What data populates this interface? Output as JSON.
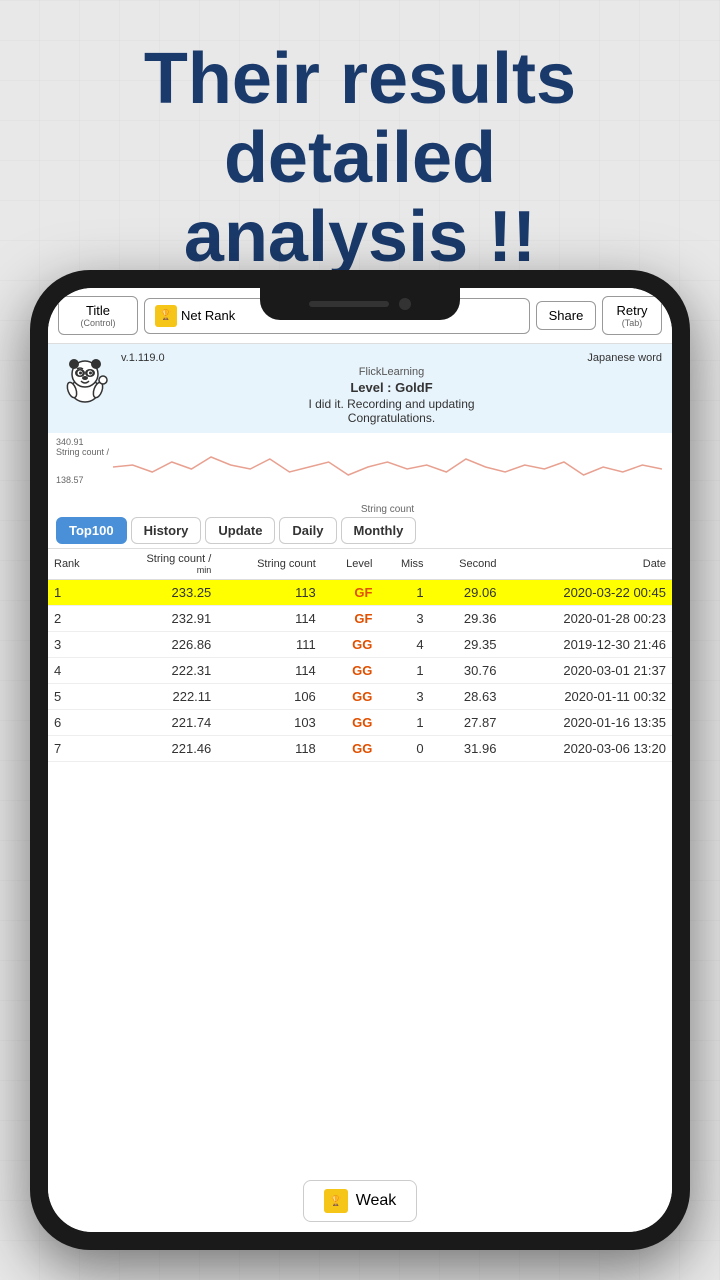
{
  "headline": {
    "line1": "Their results",
    "line2": "detailed",
    "line3": "analysis !!"
  },
  "toolbar": {
    "title_label": "Title",
    "title_sub": "(Control)",
    "net_rank_label": "Net Rank",
    "share_label": "Share",
    "retry_label": "Retry",
    "retry_sub": "(Tab)"
  },
  "info": {
    "version": "v.1.119.0",
    "app_name": "FlickLearning",
    "category": "Japanese word",
    "level": "Level : GoldF",
    "message": "I did it. Recording and updating",
    "congrats": "Congratulations."
  },
  "chart": {
    "y_max": "340.91",
    "y_label": "String count /",
    "y_min": "138.57",
    "x_label": "String count"
  },
  "tabs": [
    {
      "id": "top100",
      "label": "Top100",
      "active": true
    },
    {
      "id": "history",
      "label": "History",
      "active": false
    },
    {
      "id": "update",
      "label": "Update",
      "active": false
    },
    {
      "id": "daily",
      "label": "Daily",
      "active": false
    },
    {
      "id": "monthly",
      "label": "Monthly",
      "active": false
    }
  ],
  "table": {
    "headers": [
      {
        "label": "Rank",
        "sub": ""
      },
      {
        "label": "String count /",
        "sub": "min"
      },
      {
        "label": "String count",
        "sub": ""
      },
      {
        "label": "Level",
        "sub": ""
      },
      {
        "label": "Miss",
        "sub": ""
      },
      {
        "label": "Second",
        "sub": ""
      },
      {
        "label": "Date",
        "sub": ""
      }
    ],
    "rows": [
      {
        "rank": "1",
        "string_per_min": "233.25",
        "string_count": "113",
        "level": "GF",
        "miss": "1",
        "second": "29.06",
        "date": "2020-03-22 00:45",
        "highlight": true
      },
      {
        "rank": "2",
        "string_per_min": "232.91",
        "string_count": "114",
        "level": "GF",
        "miss": "3",
        "second": "29.36",
        "date": "2020-01-28 00:23",
        "highlight": false
      },
      {
        "rank": "3",
        "string_per_min": "226.86",
        "string_count": "111",
        "level": "GG",
        "miss": "4",
        "second": "29.35",
        "date": "2019-12-30 21:46",
        "highlight": false
      },
      {
        "rank": "4",
        "string_per_min": "222.31",
        "string_count": "114",
        "level": "GG",
        "miss": "1",
        "second": "30.76",
        "date": "2020-03-01 21:37",
        "highlight": false
      },
      {
        "rank": "5",
        "string_per_min": "222.11",
        "string_count": "106",
        "level": "GG",
        "miss": "3",
        "second": "28.63",
        "date": "2020-01-11 00:32",
        "highlight": false
      },
      {
        "rank": "6",
        "string_per_min": "221.74",
        "string_count": "103",
        "level": "GG",
        "miss": "1",
        "second": "27.87",
        "date": "2020-01-16 13:35",
        "highlight": false
      },
      {
        "rank": "7",
        "string_per_min": "221.46",
        "string_count": "118",
        "level": "GG",
        "miss": "0",
        "second": "31.96",
        "date": "2020-03-06 13:20",
        "highlight": false
      }
    ]
  },
  "weak_button": {
    "label": "Weak"
  }
}
